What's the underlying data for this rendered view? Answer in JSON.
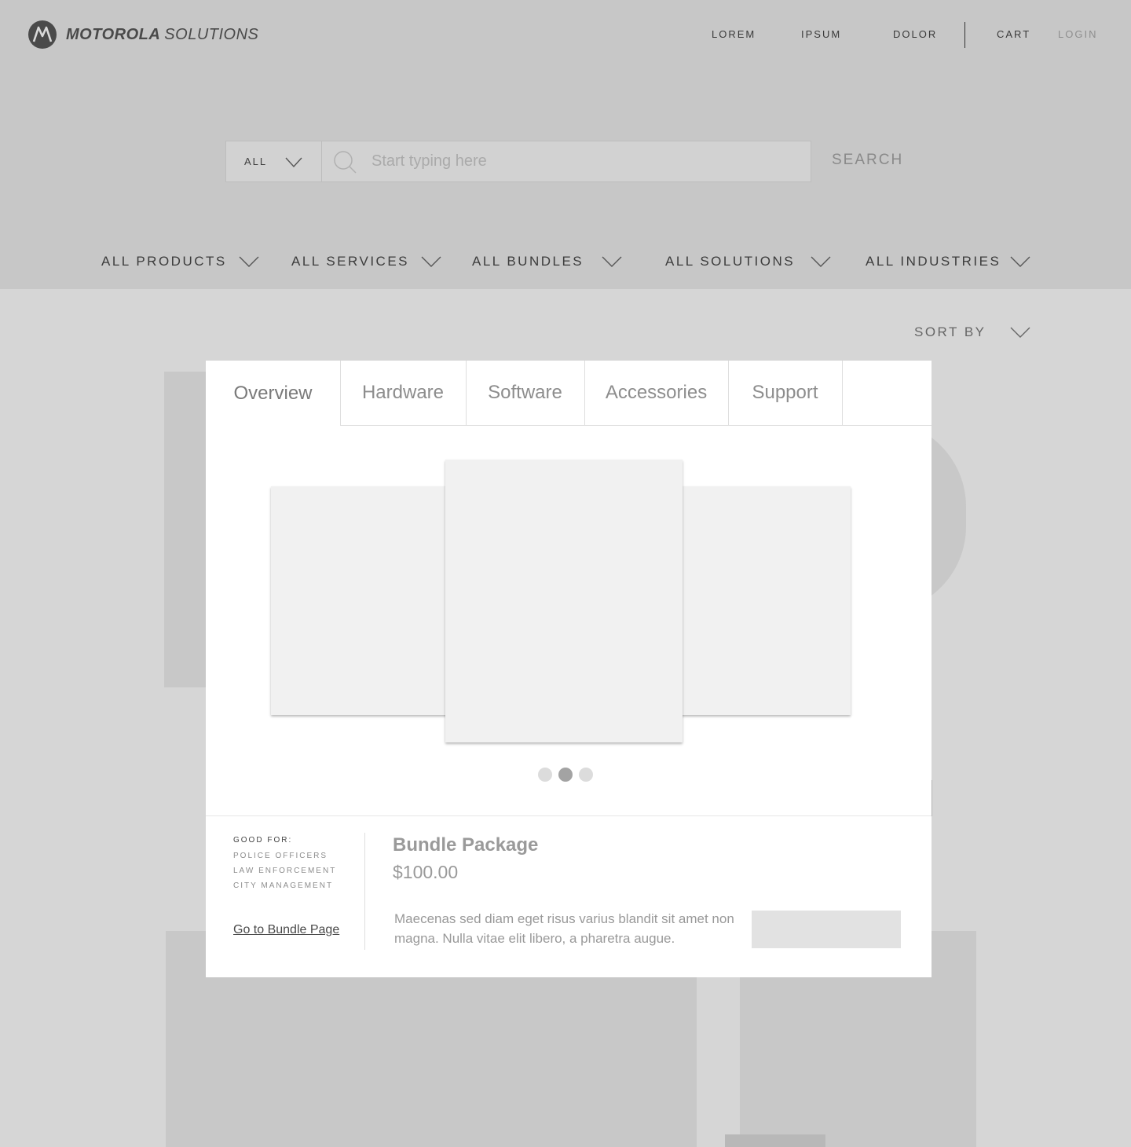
{
  "brand": {
    "name_bold": "MOTOROLA",
    "name_light": "SOLUTIONS"
  },
  "topnav": {
    "items": [
      "LOREM",
      "IPSUM",
      "DOLOR"
    ],
    "cart": "CART",
    "login": "LOGIN"
  },
  "search": {
    "filter_value": "ALL",
    "placeholder": "Start typing here",
    "button": "SEARCH"
  },
  "categories": [
    "ALL PRODUCTS",
    "ALL SERVICES",
    "ALL BUNDLES",
    "ALL SOLUTIONS",
    "ALL INDUSTRIES"
  ],
  "sort": {
    "label": "SORT BY"
  },
  "modal": {
    "tabs": [
      "Overview",
      "Hardware",
      "Software",
      "Accessories",
      "Support"
    ],
    "active_tab": "Overview",
    "carousel": {
      "slide_count": 3,
      "active_index": 1
    },
    "good_for": {
      "title": "GOOD FOR:",
      "items": [
        "POLICE OFFICERS",
        "LAW ENFORCEMENT",
        "CITY MANAGEMENT"
      ]
    },
    "bundle_link": "Go to Bundle Page",
    "product": {
      "title": "Bundle Package",
      "price": "$100.00",
      "description": "Maecenas sed diam eget risus varius blandit sit amet non magna. Nulla vitae elit libero, a pharetra augue."
    }
  },
  "colors": {
    "header_bg": "#c7c7c7",
    "page_bg": "#d6d6d6",
    "modal_bg": "#ffffff",
    "dot_active": "#a3a3a3"
  }
}
